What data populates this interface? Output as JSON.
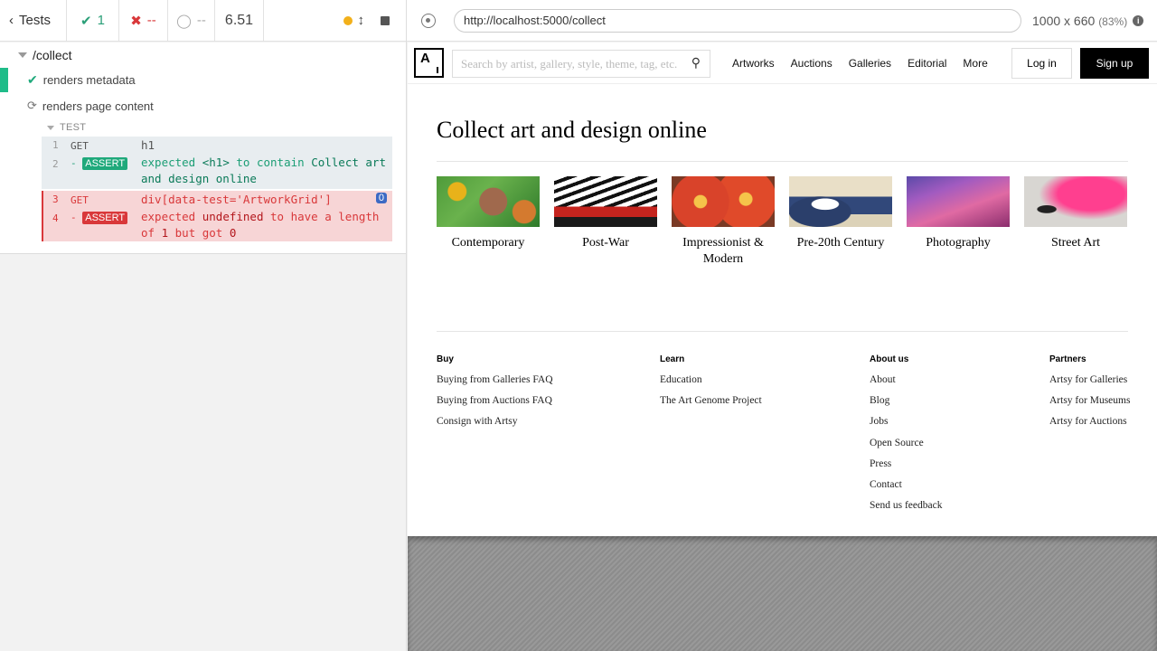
{
  "runner": {
    "back_label": "Tests",
    "passed": "1",
    "failed": "--",
    "pending": "--",
    "duration": "6.51",
    "suite": "/collect",
    "tests": [
      {
        "title": "renders metadata",
        "state": "passed"
      },
      {
        "title": "renders page content",
        "state": "running"
      }
    ],
    "test_header": "TEST",
    "commands": [
      {
        "num": "1",
        "name": "GET",
        "msg": "h1"
      },
      {
        "num": "2",
        "name": "ASSERT",
        "msg_parts": [
          "expected",
          "<h1>",
          "to contain",
          "Collect art and design online"
        ]
      },
      {
        "num": "3",
        "name": "GET",
        "msg": "div[data-test='ArtworkGrid']",
        "count": "0"
      },
      {
        "num": "4",
        "name": "ASSERT",
        "msg_parts": [
          "expected",
          "undefined",
          "to have a length of",
          "1",
          "but got",
          "0"
        ]
      }
    ]
  },
  "aut_bar": {
    "url": "http://localhost:5000/collect",
    "viewport": "1000 x 660",
    "scale": "(83%)"
  },
  "site": {
    "logo": "A",
    "search_placeholder": "Search by artist, gallery, style, theme, tag, etc.",
    "nav": [
      "Artworks",
      "Auctions",
      "Galleries",
      "Editorial",
      "More"
    ],
    "login": "Log in",
    "signup": "Sign up",
    "heading": "Collect art and design online",
    "categories": [
      {
        "label": "Contemporary"
      },
      {
        "label": "Post-War"
      },
      {
        "label": "Impressionist & Modern"
      },
      {
        "label": "Pre-20th Century"
      },
      {
        "label": "Photography"
      },
      {
        "label": "Street Art"
      }
    ],
    "footer": [
      {
        "title": "Buy",
        "links": [
          "Buying from Galleries FAQ",
          "Buying from Auctions FAQ",
          "Consign with Artsy"
        ]
      },
      {
        "title": "Learn",
        "links": [
          "Education",
          "The Art Genome Project"
        ]
      },
      {
        "title": "About us",
        "links": [
          "About",
          "Blog",
          "Jobs",
          "Open Source",
          "Press",
          "Contact",
          "Send us feedback"
        ]
      },
      {
        "title": "Partners",
        "links": [
          "Artsy for Galleries",
          "Artsy for Museums",
          "Artsy for Auctions"
        ]
      }
    ]
  }
}
